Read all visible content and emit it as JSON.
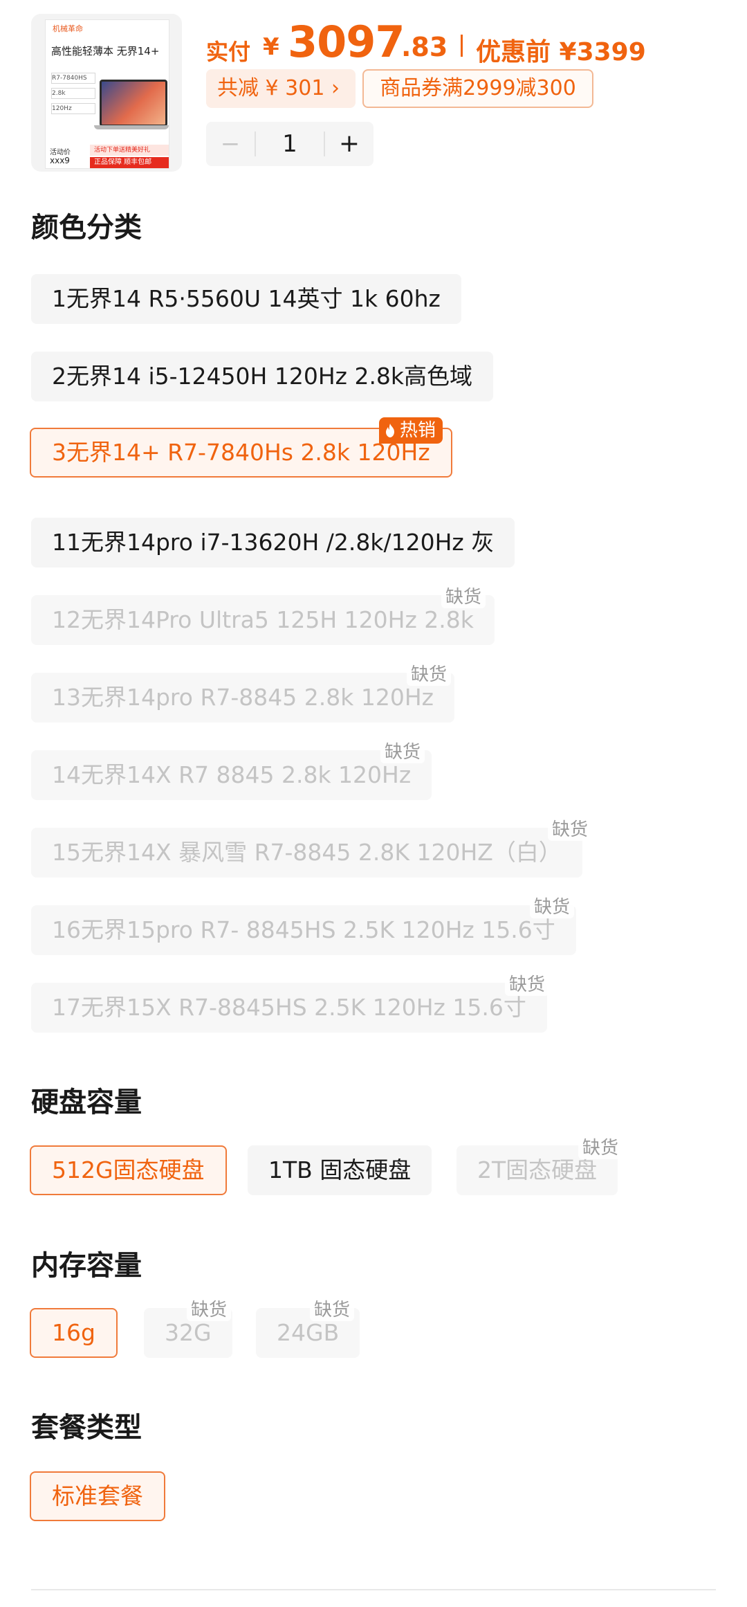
{
  "product": {
    "thumbnail": {
      "brand": "机械革命",
      "title": "高性能轻薄本 无界14+",
      "specs": [
        "R7-7840HS",
        "2.8k",
        "120Hz"
      ],
      "activity_label": "活动价",
      "activity_price": "xxx9",
      "tag_top": "活动下单送精美好礼",
      "tag_bottom": "正品保障 顺丰包邮"
    },
    "price_label": "实付",
    "currency": "¥",
    "price_int": "3097",
    "price_dec": ".83",
    "original_price_label": "优惠前 ¥3399",
    "discount_label": "共减 ¥ 301",
    "discount_arrow": "›",
    "coupon_label": "商品券满2999减300",
    "quantity": "1",
    "minus": "−",
    "plus": "+"
  },
  "colors": {
    "accent": "#f0630f",
    "disabled_text": "#c4c4c4",
    "option_bg": "#f5f5f5"
  },
  "color_section": {
    "title": "颜色分类",
    "hot_badge": "热销",
    "out_of_stock": "缺货",
    "options": [
      {
        "label": "1无界14 R5·5560U 14英寸 1k  60hz",
        "state": "normal"
      },
      {
        "label": "2无界14 i5-12450H 120Hz 2.8k高色域",
        "state": "normal"
      },
      {
        "label": "3无界14+ R7-7840Hs 2.8k 120Hz",
        "state": "selected"
      },
      {
        "label": "11无界14pro i7-13620H /2.8k/120Hz 灰",
        "state": "normal"
      },
      {
        "label": "12无界14Pro Ultra5 125H 120Hz 2.8k",
        "state": "disabled"
      },
      {
        "label": "13无界14pro R7-8845 2.8k 120Hz",
        "state": "disabled"
      },
      {
        "label": "14无界14X R7 8845 2.8k 120Hz",
        "state": "disabled"
      },
      {
        "label": "15无界14X 暴风雪 R7-8845 2.8K 120HZ（白）",
        "state": "disabled"
      },
      {
        "label": "16无界15pro R7- 8845HS 2.5K 120Hz 15.6寸",
        "state": "disabled"
      },
      {
        "label": "17无界15X R7-8845HS 2.5K 120Hz  15.6寸",
        "state": "disabled"
      }
    ]
  },
  "storage_section": {
    "title": "硬盘容量",
    "options": [
      {
        "label": "512G固态硬盘",
        "state": "selected"
      },
      {
        "label": "1TB 固态硬盘",
        "state": "normal"
      },
      {
        "label": "2T固态硬盘",
        "state": "disabled"
      }
    ]
  },
  "memory_section": {
    "title": "内存容量",
    "options": [
      {
        "label": "16g",
        "state": "selected"
      },
      {
        "label": "32G",
        "state": "disabled"
      },
      {
        "label": "24GB",
        "state": "disabled"
      }
    ]
  },
  "package_section": {
    "title": "套餐类型",
    "options": [
      {
        "label": "标准套餐",
        "state": "selected"
      }
    ]
  }
}
